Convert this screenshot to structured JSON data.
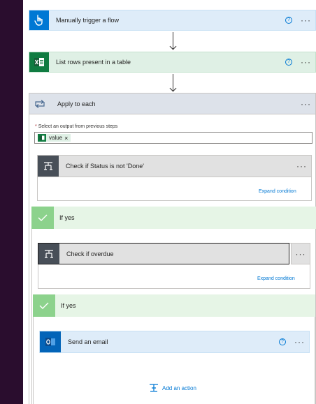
{
  "trigger": {
    "title": "Manually trigger a flow",
    "icon": "touch-hand-icon",
    "color": "#0078d4",
    "help": "?",
    "more": "···"
  },
  "list_rows": {
    "title": "List rows present in a table",
    "icon": "excel-icon",
    "color": "#107c41",
    "help": "?",
    "more": "···"
  },
  "apply_each": {
    "title": "Apply to each",
    "icon": "loop-icon",
    "more": "···",
    "field_label": "Select an output from previous steps",
    "required_mark": "*",
    "token": "value",
    "token_remove": "×"
  },
  "condition1": {
    "title": "Check if Status is not 'Done'",
    "icon": "condition-icon",
    "more": "···",
    "expand": "Expand condition"
  },
  "if_yes_1": {
    "label": "If yes"
  },
  "condition2": {
    "title": "Check if overdue",
    "icon": "condition-icon",
    "more": "···",
    "expand": "Expand condition"
  },
  "if_yes_2": {
    "label": "If yes"
  },
  "send_email": {
    "title": "Send an email",
    "icon": "outlook-icon",
    "color": "#0364b8",
    "help": "?",
    "more": "···"
  },
  "add_action": {
    "label": "Add an action",
    "icon": "add-action-icon"
  }
}
